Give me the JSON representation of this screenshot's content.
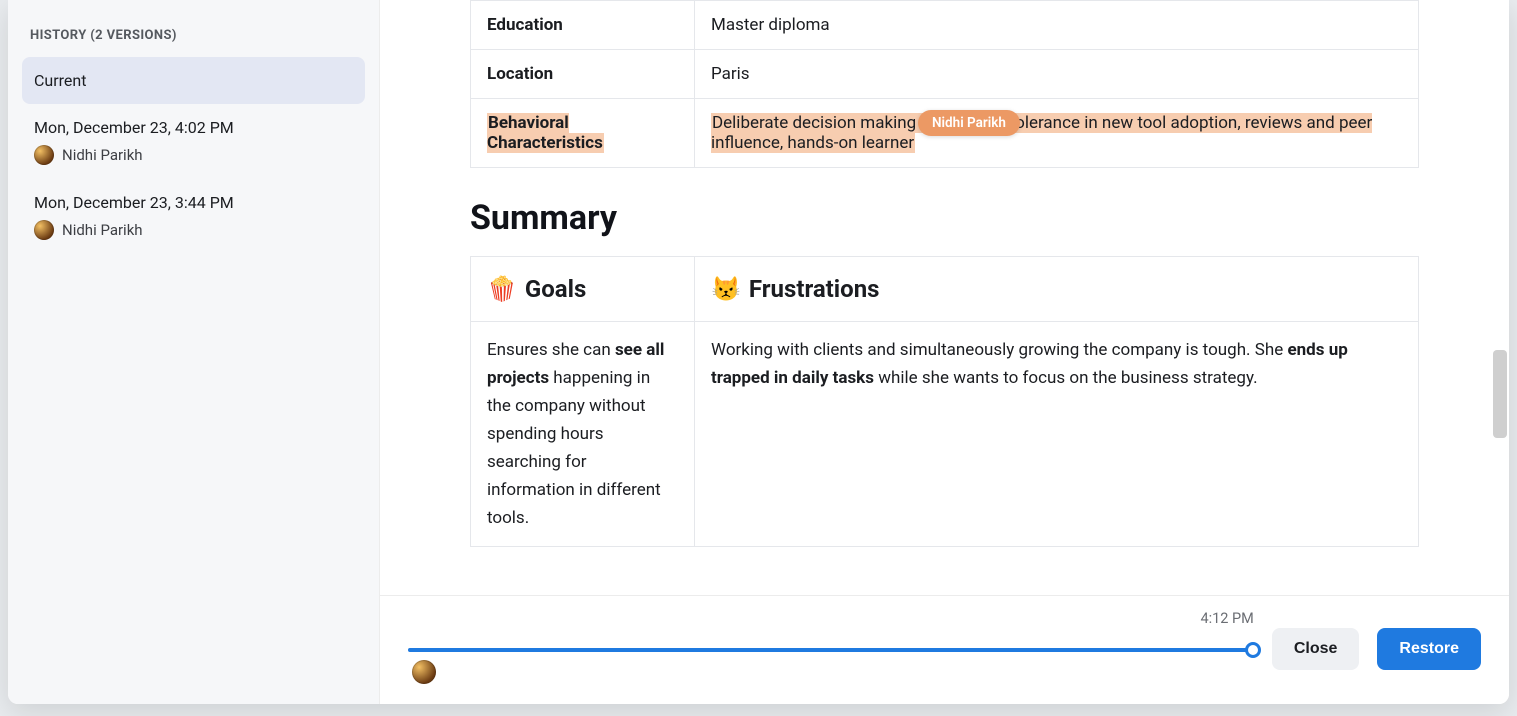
{
  "sidebar": {
    "title": "HISTORY (2 VERSIONS)",
    "versions": [
      {
        "label": "Current",
        "author": ""
      },
      {
        "label": "Mon, December 23, 4:02 PM",
        "author": "Nidhi Parikh"
      },
      {
        "label": "Mon, December 23, 3:44 PM",
        "author": "Nidhi Parikh"
      }
    ]
  },
  "content": {
    "rows": [
      {
        "label": "Education",
        "value": "Master diploma"
      },
      {
        "label": "Location",
        "value": "Paris"
      },
      {
        "label": "Behavioral Characteristics",
        "value_before": "Deliberate decision making",
        "value_after": "olerance in new tool adoption, reviews and peer influence, hands-on learner"
      }
    ],
    "edit_author": "Nidhi Parikh",
    "summary_heading": "Summary",
    "summary": {
      "goals_header": "Goals",
      "goals_emoji": "🍿",
      "goals_text_before": "Ensures she can ",
      "goals_bold": "see all projects",
      "goals_text_after": " happening in the company without spending hours searching for information in different tools.",
      "frustrations_header": "Frustrations",
      "frustrations_emoji": "😾",
      "frustrations_text_before": "Working with clients and simultaneously growing the company is tough. She ",
      "frustrations_bold": "ends up trapped in daily tasks",
      "frustrations_text_after": " while she wants to focus on the business strategy."
    }
  },
  "footer": {
    "time": "4:12 PM",
    "close": "Close",
    "restore": "Restore"
  }
}
